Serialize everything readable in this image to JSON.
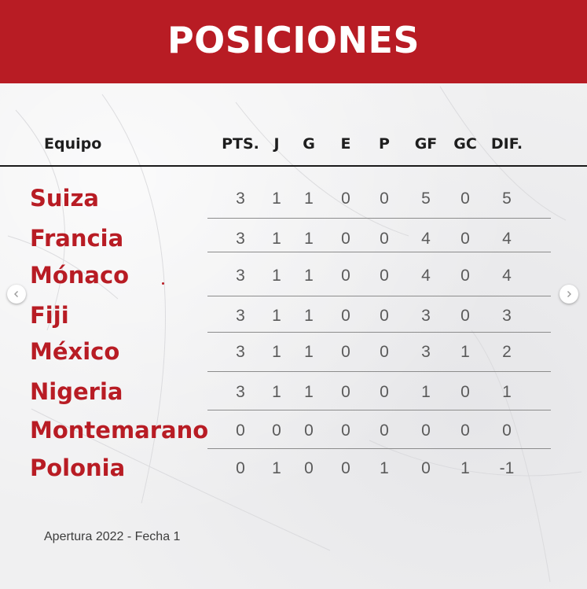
{
  "title": "POSICIONES",
  "columns": {
    "team": "Equipo",
    "pts": "PTS.",
    "j": "J",
    "g": "G",
    "e": "E",
    "p": "P",
    "gf": "GF",
    "gc": "GC",
    "dif": "DIF."
  },
  "rows": [
    {
      "team": "Suiza",
      "pts": "3",
      "j": "1",
      "g": "1",
      "e": "0",
      "p": "0",
      "gf": "5",
      "gc": "0",
      "dif": "5"
    },
    {
      "team": "Francia",
      "pts": "3",
      "j": "1",
      "g": "1",
      "e": "0",
      "p": "0",
      "gf": "4",
      "gc": "0",
      "dif": "4"
    },
    {
      "team": "Mónaco",
      "pts": "3",
      "j": "1",
      "g": "1",
      "e": "0",
      "p": "0",
      "gf": "4",
      "gc": "0",
      "dif": "4"
    },
    {
      "team": "Fiji",
      "pts": "3",
      "j": "1",
      "g": "1",
      "e": "0",
      "p": "0",
      "gf": "3",
      "gc": "0",
      "dif": "3"
    },
    {
      "team": "México",
      "pts": "3",
      "j": "1",
      "g": "1",
      "e": "0",
      "p": "0",
      "gf": "3",
      "gc": "1",
      "dif": "2"
    },
    {
      "team": "Nigeria",
      "pts": "3",
      "j": "1",
      "g": "1",
      "e": "0",
      "p": "0",
      "gf": "1",
      "gc": "0",
      "dif": "1"
    },
    {
      "team": "Montemarano",
      "pts": "0",
      "j": "0",
      "g": "0",
      "e": "0",
      "p": "0",
      "gf": "0",
      "gc": "0",
      "dif": "0"
    },
    {
      "team": "Polonia",
      "pts": "0",
      "j": "1",
      "g": "0",
      "e": "0",
      "p": "1",
      "gf": "0",
      "gc": "1",
      "dif": "-1"
    }
  ],
  "footer": "Apertura 2022 - Fecha 1",
  "nav": {
    "prev_icon": "chevron-left-icon",
    "next_icon": "chevron-right-icon"
  },
  "colors": {
    "brand_red": "#b81c24",
    "text_dark": "#1e1e1e",
    "value_gray": "#5a5a5a"
  }
}
